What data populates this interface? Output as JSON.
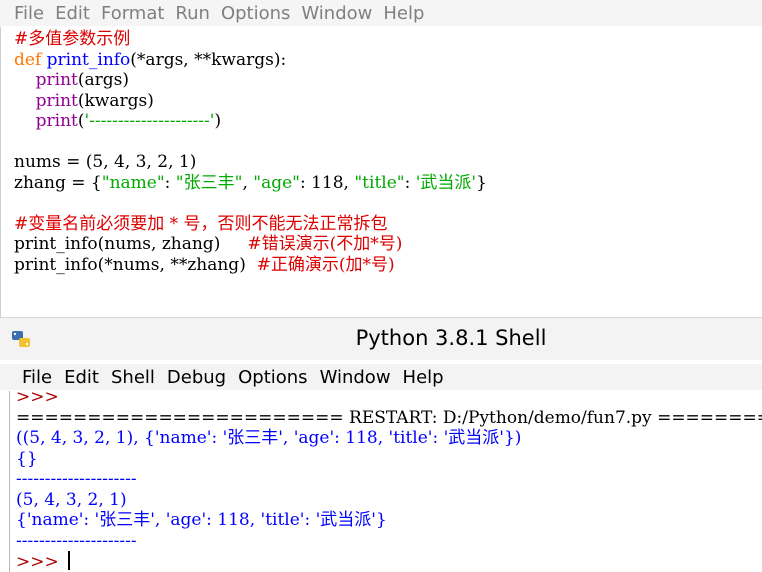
{
  "editor_menu": [
    "File",
    "Edit",
    "Format",
    "Run",
    "Options",
    "Window",
    "Help"
  ],
  "editor_code": {
    "l1": "#多值参数示例",
    "l2_kw": "def",
    "l2_fn": "print_info",
    "l2_rest": "(*args, **kwargs):",
    "l3_bi": "print",
    "l3_rest": "(args)",
    "l4_bi": "print",
    "l4_rest": "(kwargs)",
    "l5_bi": "print",
    "l5_p1": "(",
    "l5_str": "'---------------------'",
    "l5_p2": ")",
    "l7": "nums = (5, 4, 3, 2, 1)",
    "l8_a": "zhang = {",
    "l8_s1": "\"name\"",
    "l8_b": ": ",
    "l8_s2": "\"张三丰\"",
    "l8_c": ", ",
    "l8_s3": "\"age\"",
    "l8_d": ": 118, ",
    "l8_s4": "\"title\"",
    "l8_e": ": ",
    "l8_s5": "'武当派'",
    "l8_f": "}",
    "l10": "#变量名前必须要加 * 号，否则不能无法正常拆包",
    "l11_code": "print_info(nums, zhang)     ",
    "l11_cm": "#错误演示(不加*号)",
    "l12_code": "print_info(*nums, **zhang)  ",
    "l12_cm": "#正确演示(加*号)"
  },
  "shell_title": "Python 3.8.1 Shell",
  "shell_menu": [
    "File",
    "Edit",
    "Shell",
    "Debug",
    "Options",
    "Window",
    "Help"
  ],
  "shell_output": {
    "partial": ">>>",
    "restart": "======================= RESTART: D:/Python/demo/fun7.py ============",
    "o1": "((5, 4, 3, 2, 1), {'name': '张三丰', 'age': 118, 'title': '武当派'})",
    "o2": "{}",
    "o3": "---------------------",
    "o4": "(5, 4, 3, 2, 1)",
    "o5": "{'name': '张三丰', 'age': 118, 'title': '武当派'}",
    "o6": "---------------------",
    "prompt": ">>> "
  },
  "colors": {
    "keyword": "#ff7700",
    "builtin": "#900090",
    "defname": "#0000ff",
    "string": "#00aa00",
    "comment": "#dd0000",
    "output": "#0000ff",
    "prompt": "#a80000"
  }
}
